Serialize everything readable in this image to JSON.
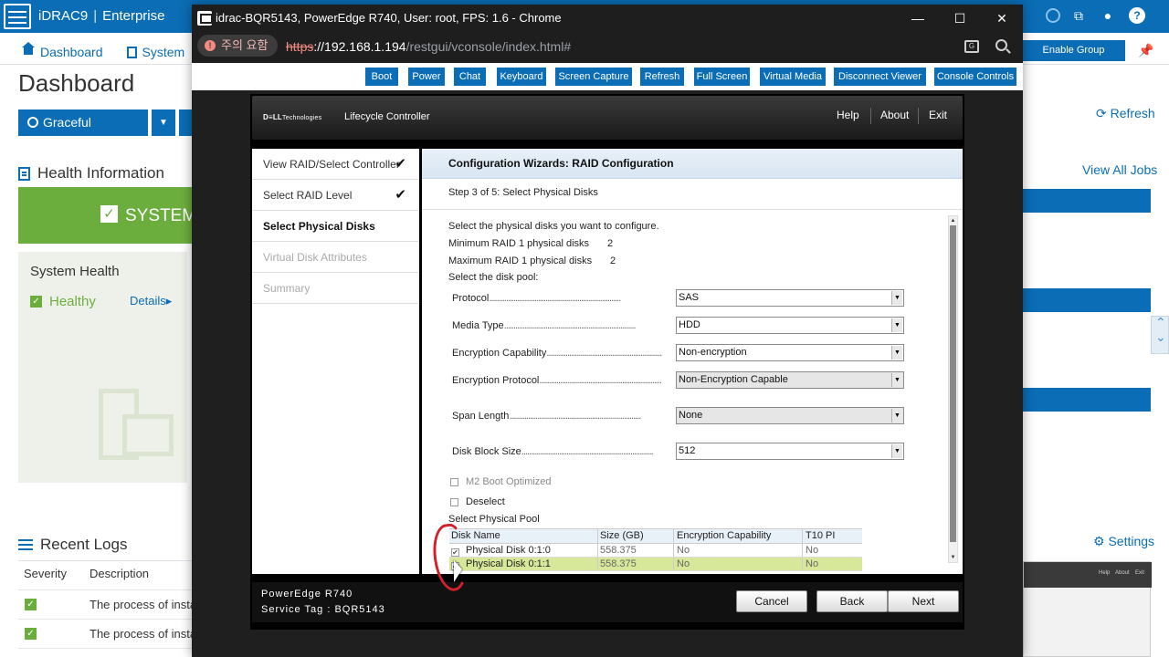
{
  "idrac": {
    "brand": "iDRAC9",
    "edition": "Enterprise",
    "nav": [
      "Dashboard",
      "System"
    ],
    "enable_group": "Enable Group Manager",
    "page_title": "Dashboard",
    "graceful_shutdown": "Graceful Shutdown",
    "refresh": "Refresh",
    "health_heading": "Health Information",
    "view_all_jobs": "View All Jobs",
    "system_banner": "SYSTEM",
    "system_health": "System Health",
    "healthy": "Healthy",
    "details": "Details",
    "recent_logs": "Recent Logs",
    "settings": "Settings",
    "logs_columns": [
      "Severity",
      "Description"
    ],
    "logs": [
      "The process of insta",
      "The process of insta"
    ],
    "colors": {
      "brand_blue": "#0a6db5",
      "healthy_green": "#6cae3e"
    }
  },
  "chrome": {
    "title": "idrac-BQR5143, PowerEdge R740, User: root, FPS: 1.6 - Chrome",
    "security_chip": "주의 요함",
    "url_proto": "https",
    "url_host": "://192.168.1.194",
    "url_path": "/restgui/vconsole/index.html#",
    "controls": {
      "minimize": "—",
      "maximize": "☐",
      "close": "✕"
    }
  },
  "vconsole": {
    "toolbar": [
      "Boot",
      "Power",
      "Chat",
      "Keyboard",
      "Screen Capture",
      "Refresh",
      "Full Screen",
      "Virtual Media",
      "Disconnect Viewer",
      "Console Controls"
    ]
  },
  "lc": {
    "logo_brand": "D≡LL",
    "logo_sub": "Technologies",
    "title": "Lifecycle Controller",
    "menu": [
      "Help",
      "About",
      "Exit"
    ],
    "steps": [
      {
        "label": "View RAID/Select Controller",
        "state": "done"
      },
      {
        "label": "Select RAID Level",
        "state": "done"
      },
      {
        "label": "Select Physical Disks",
        "state": "active"
      },
      {
        "label": "Virtual Disk Attributes",
        "state": "disabled"
      },
      {
        "label": "Summary",
        "state": "disabled"
      }
    ],
    "check_mark": "✔",
    "heading": "Configuration Wizards: RAID Configuration",
    "step": "Step 3 of 5: Select Physical Disks",
    "intro": "Select the physical disks you want to configure.",
    "min_label": "Minimum RAID 1 physical disks",
    "min_value": "2",
    "max_label": "Maximum RAID 1 physical disks",
    "max_value": "2",
    "pool_label": "Select the disk pool:",
    "fields": [
      {
        "label": "Protocol",
        "value": "SAS",
        "gray": false
      },
      {
        "label": "Media Type",
        "value": "HDD",
        "gray": false
      },
      {
        "label": "Encryption Capability",
        "value": "Non-encryption",
        "gray": false
      },
      {
        "label": "Encryption Protocol",
        "value": "Non-Encryption Capable",
        "gray": true
      },
      {
        "label": "Span Length",
        "value": "None",
        "gray": true
      },
      {
        "label": "Disk Block Size",
        "value": "512",
        "gray": false
      }
    ],
    "m2_boot": "M2 Boot Optimized",
    "deselect": "Deselect",
    "pool_heading": "Select Physical Pool",
    "table": {
      "columns": [
        "Disk Name",
        "Size (GB)",
        "Encryption Capability",
        "T10 PI"
      ],
      "rows": [
        {
          "name": "Physical Disk 0:1:0",
          "size": "558.375",
          "enc": "No",
          "t10": "No",
          "checked": true
        },
        {
          "name": "Physical Disk 0:1:1",
          "size": "558.375",
          "enc": "No",
          "t10": "No",
          "checked": true
        }
      ]
    },
    "footer": {
      "model": "PowerEdge R740",
      "service_tag": "Service Tag : BQR5143",
      "cancel": "Cancel",
      "back": "Back",
      "next": "Next"
    }
  }
}
